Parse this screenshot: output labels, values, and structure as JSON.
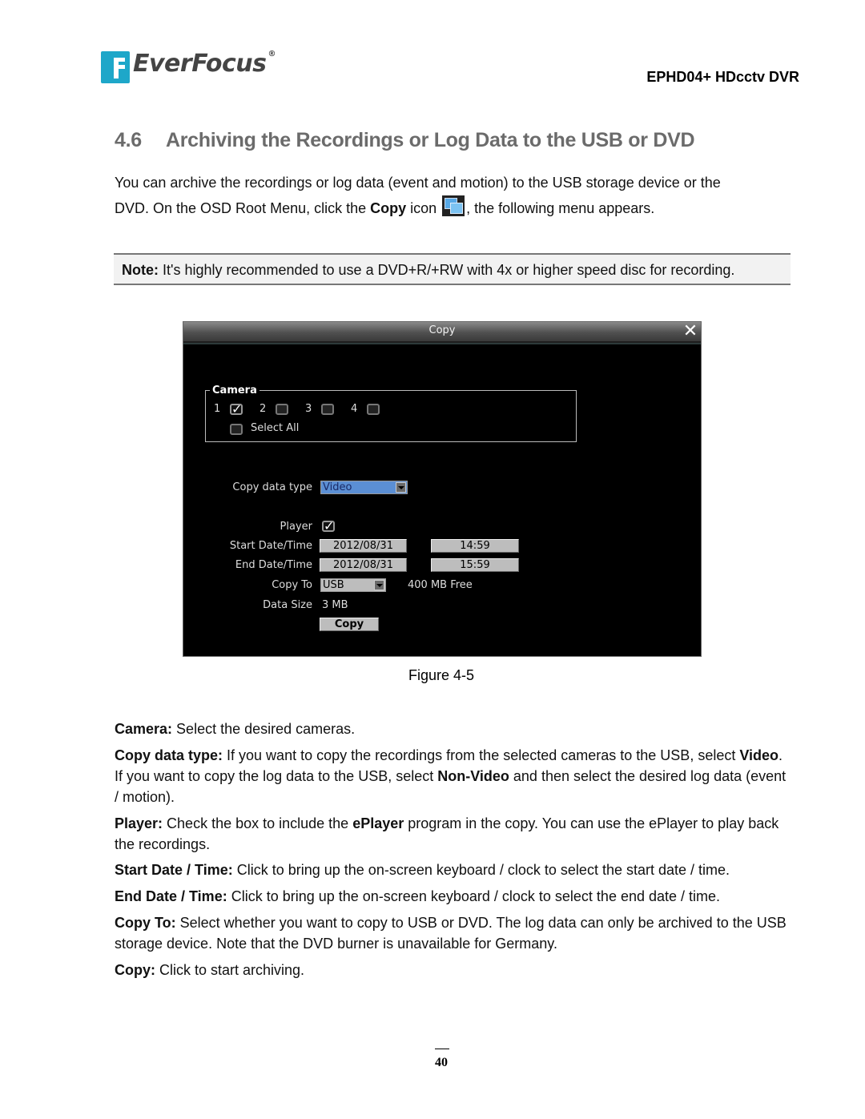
{
  "header": {
    "logo_text": "EverFocus",
    "logo_reg": "®",
    "model": "EPHD04+  HDcctv DVR"
  },
  "section": {
    "number": "4.6",
    "title": "Archiving the Recordings or Log Data to the USB or DVD"
  },
  "intro": {
    "line1": "You can archive the recordings or log data (event and motion) to the USB storage device or the",
    "line2_a": "DVD. On the OSD Root Menu, click the ",
    "line2_bold": "Copy",
    "line2_b": " icon ",
    "line2_c": ", the following menu appears.",
    "icon": "copy-icon"
  },
  "note": {
    "label": "Note:",
    "text": " It's highly recommended to use a DVD+R/+RW with 4x or higher speed disc for recording."
  },
  "osd": {
    "title": "Copy",
    "close_glyph": "✕",
    "camera_legend": "Camera",
    "cameras": [
      {
        "label": "1",
        "checked": true
      },
      {
        "label": "2",
        "checked": false
      },
      {
        "label": "3",
        "checked": false
      },
      {
        "label": "4",
        "checked": false
      }
    ],
    "select_all_label": "Select All",
    "select_all_checked": false,
    "copy_data_type_label": "Copy data type",
    "copy_data_type_value": "Video",
    "player_label": "Player",
    "player_checked": true,
    "start_label": "Start Date/Time",
    "start_date": "2012/08/31",
    "start_time": "14:59",
    "end_label": "End Date/Time",
    "end_date": "2012/08/31",
    "end_time": "15:59",
    "copy_to_label": "Copy To",
    "copy_to_value": "USB",
    "free_space": "400 MB Free",
    "data_size_label": "Data Size",
    "data_size_value": "3 MB",
    "copy_button": "Copy",
    "colors": {
      "dropdown_selected_bg": "#5b8fd4",
      "button_bg": "#bdbdbd"
    }
  },
  "figure_caption": "Figure 4-5",
  "descriptions": [
    {
      "term": "Camera:",
      "text": " Select the desired cameras."
    },
    {
      "term": "Copy data type:",
      "parts": [
        " If you want to copy the recordings from the selected cameras to the USB, select ",
        "Video",
        ". If you want to copy the log data to the USB, select ",
        "Non-Video",
        " and then select the desired log data (event / motion)."
      ]
    },
    {
      "term": "Player:",
      "parts": [
        " Check the box to include the ",
        "ePlayer",
        " program in the copy. You can use the ePlayer to play back the recordings."
      ]
    },
    {
      "term": "Start Date / Time:",
      "text": " Click to bring up the on-screen keyboard / clock to select the start date / time."
    },
    {
      "term": "End Date / Time:",
      "text": " Click to bring up the on-screen keyboard / clock to select the end date / time."
    },
    {
      "term": "Copy To:",
      "text": " Select whether you want to copy to USB or DVD. The log data can only be archived to the USB storage device. Note that the DVD burner is unavailable for Germany."
    },
    {
      "term": "Copy:",
      "text": " Click to start archiving."
    }
  ],
  "page_number": "40"
}
